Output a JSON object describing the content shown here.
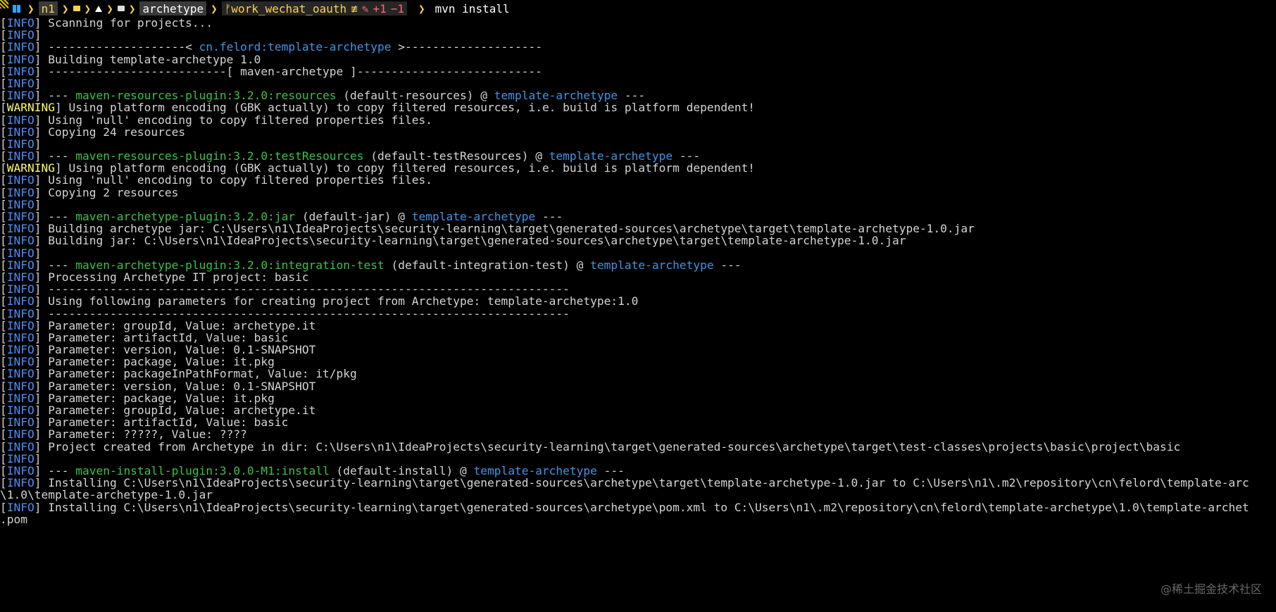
{
  "prompt": {
    "user": "n1",
    "dir": "archetype",
    "git_branch": "work_wechat_oauth",
    "git_approx": "≢",
    "git_plus": "+1",
    "git_minus": "−1",
    "git_mod_icon": "✎",
    "arrow": "❯",
    "command": "mvn install"
  },
  "icons": {
    "windows": "windows-icon",
    "folder": "folder-icon",
    "home": "home-icon",
    "branch": "git-branch-icon"
  },
  "colors": {
    "info": "#4c8ef5",
    "warning": "#ffff66",
    "plugin": "#3cc24a",
    "artifact": "#3e96e6",
    "accent": "#ffd24a"
  },
  "watermark": "@稀土掘金技术社区",
  "log": [
    {
      "level": "INFO",
      "text": "Scanning for projects..."
    },
    {
      "level": "INFO",
      "text": ""
    },
    {
      "level": "INFO",
      "parts": [
        {
          "t": "--------------------< "
        },
        {
          "t": "cn.felord:template-archetype",
          "c": "artifact"
        },
        {
          "t": " >--------------------"
        }
      ]
    },
    {
      "level": "INFO",
      "text": "Building template-archetype 1.0"
    },
    {
      "level": "INFO",
      "text": "--------------------------[ maven-archetype ]---------------------------"
    },
    {
      "level": "INFO",
      "text": ""
    },
    {
      "level": "INFO",
      "parts": [
        {
          "t": "--- "
        },
        {
          "t": "maven-resources-plugin:3.2.0:resources",
          "c": "plugin"
        },
        {
          "t": " (default-resources) @ "
        },
        {
          "t": "template-archetype",
          "c": "artifact"
        },
        {
          "t": " ---"
        }
      ]
    },
    {
      "level": "WARNING",
      "text": "Using platform encoding (GBK actually) to copy filtered resources, i.e. build is platform dependent!"
    },
    {
      "level": "INFO",
      "text": "Using 'null' encoding to copy filtered properties files."
    },
    {
      "level": "INFO",
      "text": "Copying 24 resources"
    },
    {
      "level": "INFO",
      "text": ""
    },
    {
      "level": "INFO",
      "parts": [
        {
          "t": "--- "
        },
        {
          "t": "maven-resources-plugin:3.2.0:testResources",
          "c": "plugin"
        },
        {
          "t": " (default-testResources) @ "
        },
        {
          "t": "template-archetype",
          "c": "artifact"
        },
        {
          "t": " ---"
        }
      ]
    },
    {
      "level": "WARNING",
      "text": "Using platform encoding (GBK actually) to copy filtered resources, i.e. build is platform dependent!"
    },
    {
      "level": "INFO",
      "text": "Using 'null' encoding to copy filtered properties files."
    },
    {
      "level": "INFO",
      "text": "Copying 2 resources"
    },
    {
      "level": "INFO",
      "text": ""
    },
    {
      "level": "INFO",
      "parts": [
        {
          "t": "--- "
        },
        {
          "t": "maven-archetype-plugin:3.2.0:jar",
          "c": "plugin"
        },
        {
          "t": " (default-jar) @ "
        },
        {
          "t": "template-archetype",
          "c": "artifact"
        },
        {
          "t": " ---"
        }
      ]
    },
    {
      "level": "INFO",
      "text": "Building archetype jar: C:\\Users\\n1\\IdeaProjects\\security-learning\\target\\generated-sources\\archetype\\target\\template-archetype-1.0.jar"
    },
    {
      "level": "INFO",
      "text": "Building jar: C:\\Users\\n1\\IdeaProjects\\security-learning\\target\\generated-sources\\archetype\\target\\template-archetype-1.0.jar"
    },
    {
      "level": "INFO",
      "text": ""
    },
    {
      "level": "INFO",
      "parts": [
        {
          "t": "--- "
        },
        {
          "t": "maven-archetype-plugin:3.2.0:integration-test",
          "c": "plugin"
        },
        {
          "t": " (default-integration-test) @ "
        },
        {
          "t": "template-archetype",
          "c": "artifact"
        },
        {
          "t": " ---"
        }
      ]
    },
    {
      "level": "INFO",
      "text": "Processing Archetype IT project: basic"
    },
    {
      "level": "INFO",
      "text": "----------------------------------------------------------------------------"
    },
    {
      "level": "INFO",
      "text": "Using following parameters for creating project from Archetype: template-archetype:1.0"
    },
    {
      "level": "INFO",
      "text": "----------------------------------------------------------------------------"
    },
    {
      "level": "INFO",
      "text": "Parameter: groupId, Value: archetype.it"
    },
    {
      "level": "INFO",
      "text": "Parameter: artifactId, Value: basic"
    },
    {
      "level": "INFO",
      "text": "Parameter: version, Value: 0.1-SNAPSHOT"
    },
    {
      "level": "INFO",
      "text": "Parameter: package, Value: it.pkg"
    },
    {
      "level": "INFO",
      "text": "Parameter: packageInPathFormat, Value: it/pkg"
    },
    {
      "level": "INFO",
      "text": "Parameter: version, Value: 0.1-SNAPSHOT"
    },
    {
      "level": "INFO",
      "text": "Parameter: package, Value: it.pkg"
    },
    {
      "level": "INFO",
      "text": "Parameter: groupId, Value: archetype.it"
    },
    {
      "level": "INFO",
      "text": "Parameter: artifactId, Value: basic"
    },
    {
      "level": "INFO",
      "text": "Parameter: ?????, Value: ????"
    },
    {
      "level": "INFO",
      "text": "Project created from Archetype in dir: C:\\Users\\n1\\IdeaProjects\\security-learning\\target\\generated-sources\\archetype\\target\\test-classes\\projects\\basic\\project\\basic"
    },
    {
      "level": "INFO",
      "text": ""
    },
    {
      "level": "INFO",
      "parts": [
        {
          "t": "--- "
        },
        {
          "t": "maven-install-plugin:3.0.0-M1:install",
          "c": "plugin"
        },
        {
          "t": " (default-install) @ "
        },
        {
          "t": "template-archetype",
          "c": "artifact"
        },
        {
          "t": " ---"
        }
      ]
    },
    {
      "level": "INFO",
      "text": "Installing C:\\Users\\n1\\IdeaProjects\\security-learning\\target\\generated-sources\\archetype\\target\\template-archetype-1.0.jar to C:\\Users\\n1\\.m2\\repository\\cn\\felord\\template-arc"
    },
    {
      "raw": "\\1.0\\template-archetype-1.0.jar"
    },
    {
      "level": "INFO",
      "text": "Installing C:\\Users\\n1\\IdeaProjects\\security-learning\\target\\generated-sources\\archetype\\pom.xml to C:\\Users\\n1\\.m2\\repository\\cn\\felord\\template-archetype\\1.0\\template-archet"
    },
    {
      "raw": ".pom"
    }
  ]
}
